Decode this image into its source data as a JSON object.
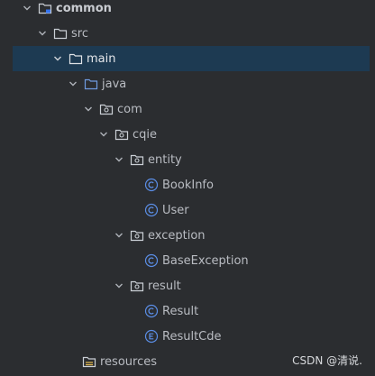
{
  "tree": {
    "common": "common",
    "src": "src",
    "main": "main",
    "java": "java",
    "com": "com",
    "cqie": "cqie",
    "entity": "entity",
    "bookinfo": "BookInfo",
    "user": "User",
    "exception": "exception",
    "baseexception": "BaseException",
    "result_pkg": "result",
    "result_class": "Result",
    "resultcde": "ResultCde",
    "resources": "resources"
  },
  "watermark": "CSDN @清说.",
  "colors": {
    "background": "#2b2d30",
    "selection": "#1d3a52",
    "folder_outline": "#cbd0d6",
    "source_folder": "#6f9be0",
    "class_icon": "#5b8ee6",
    "enum_icon": "#5b8ee6"
  },
  "icons": {
    "module": "module-folder-icon",
    "folder": "folder-icon",
    "source_root": "source-folder-icon",
    "package": "package-icon",
    "class": "class-icon",
    "enum": "enum-icon",
    "resources": "resources-folder-icon",
    "expanded": "chevron-down-icon"
  }
}
